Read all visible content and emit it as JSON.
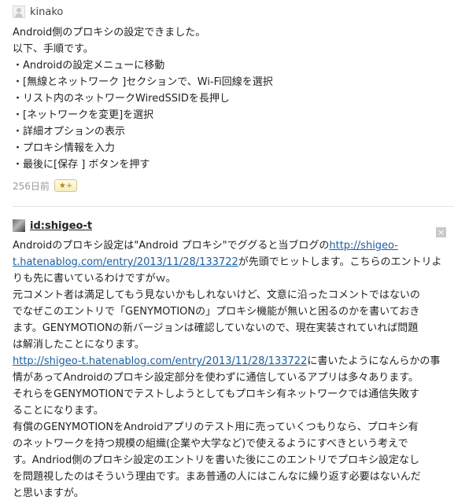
{
  "comment1": {
    "username": "kinako",
    "lines": [
      "Android側のプロキシの設定できました。",
      "以下、手順です。",
      "・Androidの設定メニューに移動",
      "・[無線とネットワーク ]セクションで、Wi-Fi回線を選択",
      "・リスト内のネットワークWiredSSIDを長押し",
      "・[ネットワークを変更]を選択",
      "・詳細オプションの表示",
      "・プロキシ情報を入力",
      "・最後に[保存 ] ボタンを押す"
    ],
    "time": "256日前",
    "star_label": "★+"
  },
  "comment2": {
    "username": "id:shigeo-t",
    "close_glyph": "×",
    "text": {
      "l1a": "Androidのプロキシ設定は\"Android プロキシ\"でググると当ブログの",
      "link1a": "http://shigeo-",
      "link1b": "t.hatenablog.com/entry/2013/11/28/133722",
      "l2b": "が先頭でヒットします。こちらのエントリよ",
      "l3": "りも先に書いているわけですがｗ。",
      "l4": "元コメント者は満足してもう見ないかもしれないけど、文意に沿ったコメントではないの",
      "l5": "でなぜこのエントリで「GENYMOTIONの」プロキシ機能が無いと困るのかを書いておき",
      "l6": "ます。GENYMOTIONの新バージョンは確認していないので、現在実装されていれば問題",
      "l7": "は解消したことになります。",
      "link2": "http://shigeo-t.hatenablog.com/entry/2013/11/28/133722",
      "l8b": "に書いたようになんらかの事",
      "l9": "情があってAndroidのプロキシ設定部分を使わずに通信しているアプリは多々あります。",
      "l10": "それらをGENYMOTIONでテストしようとしてもプロキシ有ネットワークでは通信失敗す",
      "l11": "ることになります。",
      "l12": "有償のGENYMOTIONをAndroidアプリのテスト用に売っていくつもりなら、プロキシ有",
      "l13": "のネットワークを持つ規模の組織(企業や大学など)で使えるようにすべきという考えで",
      "l14": "す。Andriod側のプロキシ設定のエントリを書いた後にこのエントリでプロキシ設定なし",
      "l15": "を問題視したのはそういう理由です。まあ普通の人にはこんなに繰り返す必要はないんだ",
      "l16": "と思いますが。"
    }
  }
}
